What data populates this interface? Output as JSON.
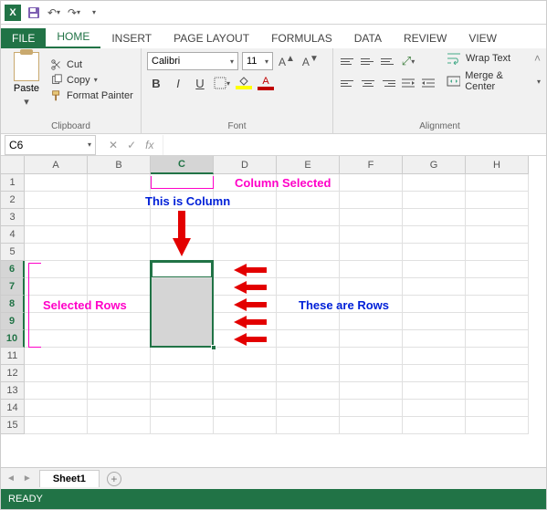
{
  "qat": {
    "logo": "X"
  },
  "tabs": {
    "file": "FILE",
    "home": "HOME",
    "insert": "INSERT",
    "page_layout": "PAGE LAYOUT",
    "formulas": "FORMULAS",
    "data": "DATA",
    "review": "REVIEW",
    "view": "VIEW"
  },
  "ribbon": {
    "clipboard": {
      "label": "Clipboard",
      "paste": "Paste",
      "cut": "Cut",
      "copy": "Copy",
      "format_painter": "Format Painter"
    },
    "font": {
      "label": "Font",
      "name": "Calibri",
      "size": "11",
      "bold": "B",
      "italic": "I",
      "underline": "U"
    },
    "alignment": {
      "label": "Alignment",
      "wrap": "Wrap Text",
      "merge": "Merge & Center"
    }
  },
  "namebox": {
    "ref": "C6",
    "fx": "fx"
  },
  "columns": [
    "A",
    "B",
    "C",
    "D",
    "E",
    "F",
    "G",
    "H"
  ],
  "rows": [
    "1",
    "2",
    "3",
    "4",
    "5",
    "6",
    "7",
    "8",
    "9",
    "10",
    "11",
    "12",
    "13",
    "14",
    "15"
  ],
  "selected_col_index": 2,
  "selected_rows": [
    5,
    6,
    7,
    8,
    9
  ],
  "annotations": {
    "column_selected": "Column Selected",
    "this_is_column": "This is Column",
    "selected_rows": "Selected Rows",
    "these_are_rows": "These are Rows"
  },
  "sheets": {
    "scroll": "",
    "active": "Sheet1"
  },
  "status": "READY"
}
